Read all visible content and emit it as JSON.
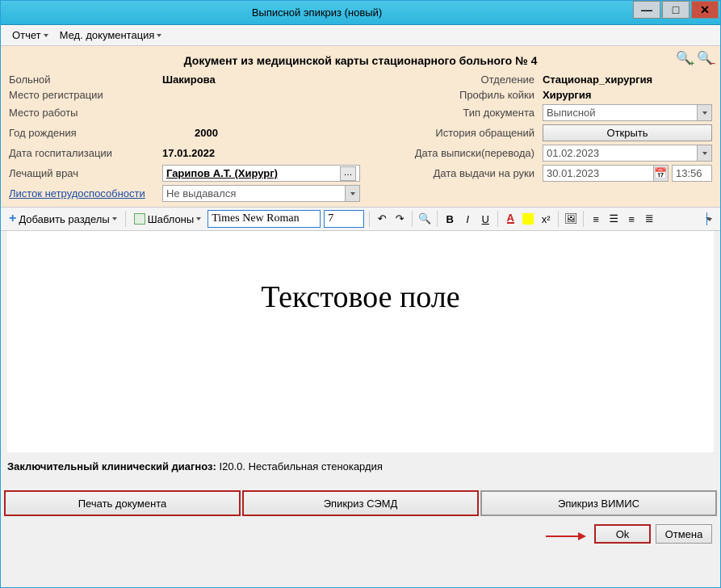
{
  "window": {
    "title": "Выписной эпикриз (новый)"
  },
  "menu": {
    "report": "Отчет",
    "meddoc": "Мед. документация"
  },
  "header": {
    "doc_title": "Документ из медицинской карты стационарного больного №  4",
    "labels": {
      "patient": "Больной",
      "reg_place": "Место регистрации",
      "work_place": "Место работы",
      "birth_year": "Год рождения",
      "hosp_date": "Дата госпитализации",
      "doctor": "Лечащий врач",
      "disability_sheet": "Листок нетрудоспособности",
      "department": "Отделение",
      "bed_profile": "Профиль койки",
      "doc_type": "Тип документа",
      "history": "История обращений",
      "discharge_date": "Дата выписки(перевода)",
      "issue_date": "Дата выдачи на руки"
    },
    "values": {
      "patient": "Шакирова",
      "birth_year": "2000",
      "hosp_date": "17.01.2022",
      "doctor": "Гарипов А.Т. (Хирург)",
      "disability_sheet": "Не выдавался",
      "department": "Стационар_хирургия",
      "bed_profile": "Хирургия",
      "doc_type": "Выписной",
      "history_btn": "Открыть",
      "discharge_date": "01.02.2023",
      "issue_date": "30.01.2023",
      "issue_time": "13:56"
    }
  },
  "toolbar": {
    "add_sections": "Добавить разделы",
    "templates": "Шаблоны",
    "font_name": "Times New Roman",
    "font_size": "7"
  },
  "editor": {
    "body_text": "Текстовое поле"
  },
  "diagnosis": {
    "label": "Заключительный клинический диагноз:",
    "value": "I20.0. Нестабильная стенокардия"
  },
  "bottom": {
    "print": "Печать документа",
    "semd": "Эпикриз СЭМД",
    "vimis": "Эпикриз ВИМИС"
  },
  "footer": {
    "ok": "Ok",
    "cancel": "Отмена"
  }
}
